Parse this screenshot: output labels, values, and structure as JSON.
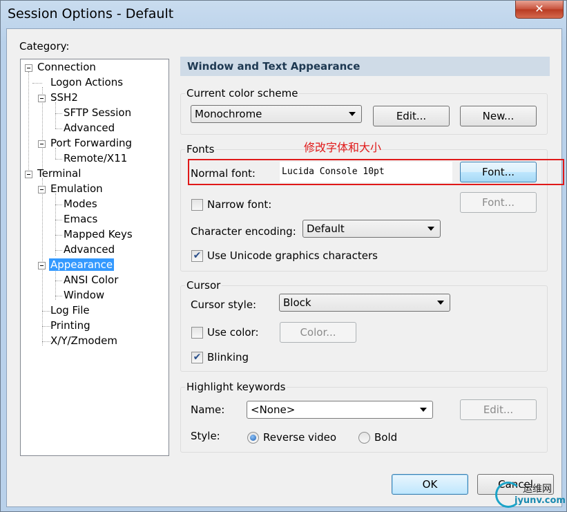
{
  "window": {
    "title": "Session Options - Default",
    "close_glyph": "✕"
  },
  "category": {
    "label": "Category:",
    "tree": [
      {
        "label": "Connection",
        "expanded": true
      },
      {
        "label": "Logon Actions"
      },
      {
        "label": "SSH2",
        "expanded": true
      },
      {
        "label": "SFTP Session"
      },
      {
        "label": "Advanced"
      },
      {
        "label": "Port Forwarding",
        "expanded": true
      },
      {
        "label": "Remote/X11"
      },
      {
        "label": "Terminal",
        "expanded": true
      },
      {
        "label": "Emulation",
        "expanded": true
      },
      {
        "label": "Modes"
      },
      {
        "label": "Emacs"
      },
      {
        "label": "Mapped Keys"
      },
      {
        "label": "Advanced"
      },
      {
        "label": "Appearance",
        "expanded": true,
        "selected": true
      },
      {
        "label": "ANSI Color"
      },
      {
        "label": "Window"
      },
      {
        "label": "Log File"
      },
      {
        "label": "Printing"
      },
      {
        "label": "X/Y/Zmodem"
      }
    ]
  },
  "panel": {
    "header": "Window and Text Appearance",
    "color_scheme": {
      "group_title": "Current color scheme",
      "value": "Monochrome",
      "edit_label": "Edit...",
      "new_label": "New..."
    },
    "fonts": {
      "group_title": "Fonts",
      "annotation": "修改字体和大小",
      "normal_font_label": "Normal font:",
      "normal_font_value": "Lucida Console 10pt",
      "font_button": "Font...",
      "narrow_font_label": "Narrow font:",
      "narrow_font_checked": false,
      "narrow_font_button": "Font...",
      "encoding_label": "Character encoding:",
      "encoding_value": "Default",
      "unicode_label": "Use Unicode graphics characters",
      "unicode_checked": true
    },
    "cursor": {
      "group_title": "Cursor",
      "style_label": "Cursor style:",
      "style_value": "Block",
      "use_color_label": "Use color:",
      "use_color_checked": false,
      "color_button": "Color...",
      "blinking_label": "Blinking",
      "blinking_checked": true
    },
    "highlight": {
      "group_title": "Highlight keywords",
      "name_label": "Name:",
      "name_value": "<None>",
      "edit_label": "Edit...",
      "style_label": "Style:",
      "reverse_label": "Reverse video",
      "bold_label": "Bold",
      "selected_style": "Reverse video"
    }
  },
  "footer": {
    "ok_label": "OK",
    "cancel_label": "Cancel"
  },
  "watermark": {
    "line1": "运维网",
    "line2": "iyunv.com"
  },
  "colors": {
    "selection": "#3399ff",
    "annotation_red": "#e01818"
  }
}
